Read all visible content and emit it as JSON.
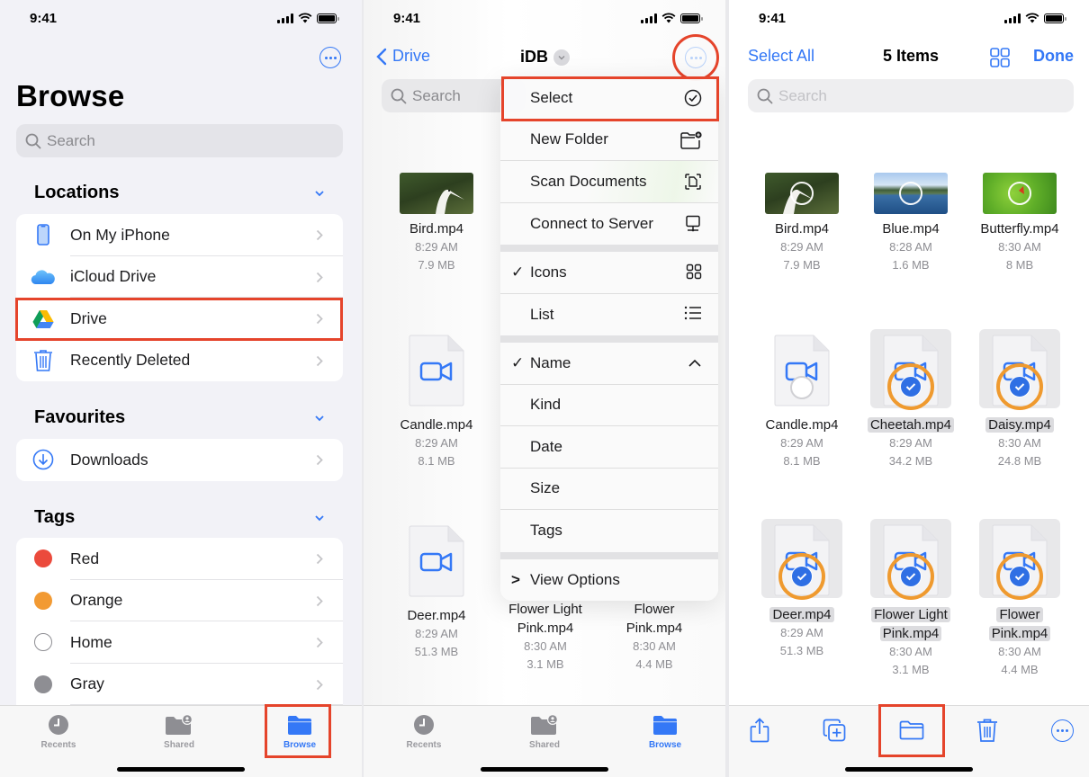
{
  "status_bar": {
    "time": "9:41"
  },
  "colors": {
    "accent": "#3478f6",
    "highlight": "#e5442b",
    "ring": "#ef9a2f",
    "check": "#2f6fe4"
  },
  "panel1": {
    "title": "Browse",
    "more_icon": "ellipsis-circle-icon",
    "search_placeholder": "Search",
    "sections": {
      "locations": {
        "title": "Locations",
        "items": [
          {
            "label": "On My iPhone",
            "icon": "iphone-icon"
          },
          {
            "label": "iCloud Drive",
            "icon": "icloud-icon"
          },
          {
            "label": "Drive",
            "icon": "google-drive-icon",
            "highlighted": true
          },
          {
            "label": "Recently Deleted",
            "icon": "trash-icon"
          }
        ]
      },
      "favourites": {
        "title": "Favourites",
        "items": [
          {
            "label": "Downloads",
            "icon": "download-circle-icon"
          }
        ]
      },
      "tags": {
        "title": "Tags",
        "items": [
          {
            "label": "Red",
            "color": "#eb4a3c"
          },
          {
            "label": "Orange",
            "color": "#f29a33"
          },
          {
            "label": "Home",
            "color": "#ffffff"
          },
          {
            "label": "Gray",
            "color": "#8e8e93"
          }
        ]
      }
    },
    "tabs": [
      {
        "label": "Recents",
        "icon": "clock-icon"
      },
      {
        "label": "Shared",
        "icon": "shared-folder-icon"
      },
      {
        "label": "Browse",
        "icon": "folder-icon",
        "active": true
      }
    ]
  },
  "panel2": {
    "back_label": "Drive",
    "title": "iDB",
    "search_placeholder": "Search",
    "files": [
      {
        "name": "Bird.mp4",
        "time": "8:29 AM",
        "size": "7.9 MB"
      },
      {
        "name": "Candle.mp4",
        "time": "8:29 AM",
        "size": "8.1 MB"
      },
      {
        "name": "Deer.mp4",
        "time": "8:29 AM",
        "size": "51.3 MB"
      },
      {
        "name": "Flower Light Pink.mp4",
        "name_l1": "Flower Light",
        "name_l2": "Pink.mp4",
        "time": "8:30 AM",
        "size": "3.1 MB"
      },
      {
        "name": "Flower Pink.mp4",
        "name_l1": "Flower",
        "name_l2": "Pink.mp4",
        "time": "8:30 AM",
        "size": "4.4 MB"
      }
    ],
    "menu": {
      "group1": [
        {
          "label": "Select",
          "icon": "checkmark-circle-icon",
          "highlighted": true
        },
        {
          "label": "New Folder",
          "icon": "new-folder-icon"
        },
        {
          "label": "Scan Documents",
          "icon": "scan-document-icon"
        },
        {
          "label": "Connect to Server",
          "icon": "server-display-icon"
        }
      ],
      "group2": [
        {
          "label": "Icons",
          "checked": true,
          "icon": "grid-icon"
        },
        {
          "label": "List",
          "checked": false,
          "icon": "list-icon"
        }
      ],
      "group3": [
        {
          "label": "Name",
          "checked": true,
          "icon": "chevron-up-icon"
        },
        {
          "label": "Kind"
        },
        {
          "label": "Date"
        },
        {
          "label": "Size"
        },
        {
          "label": "Tags"
        }
      ],
      "view_options": "View Options",
      "check_glyph": "✓",
      "chevron_glyph": ">"
    },
    "tabs": [
      {
        "label": "Recents"
      },
      {
        "label": "Shared"
      },
      {
        "label": "Browse",
        "active": true
      }
    ]
  },
  "panel3": {
    "select_all": "Select All",
    "title": "5 Items",
    "done": "Done",
    "search_placeholder": "Search",
    "files": [
      {
        "name": "Bird.mp4",
        "time": "8:29 AM",
        "size": "7.9 MB",
        "selected": false
      },
      {
        "name": "Blue.mp4",
        "time": "8:28 AM",
        "size": "1.6 MB",
        "selected": false
      },
      {
        "name": "Butterfly.mp4",
        "time": "8:30 AM",
        "size": "8 MB",
        "selected": false
      },
      {
        "name": "Candle.mp4",
        "time": "8:29 AM",
        "size": "8.1 MB",
        "selected": false
      },
      {
        "name": "Cheetah.mp4",
        "time": "8:29 AM",
        "size": "34.2 MB",
        "selected": true
      },
      {
        "name": "Daisy.mp4",
        "time": "8:30 AM",
        "size": "24.8 MB",
        "selected": true
      },
      {
        "name": "Deer.mp4",
        "time": "8:29 AM",
        "size": "51.3 MB",
        "selected": true
      },
      {
        "name": "Flower Light Pink.mp4",
        "name_l1": "Flower Light",
        "name_l2": "Pink.mp4",
        "time": "8:30 AM",
        "size": "3.1 MB",
        "selected": true
      },
      {
        "name": "Flower Pink.mp4",
        "name_l1": "Flower",
        "name_l2": "Pink.mp4",
        "time": "8:30 AM",
        "size": "4.4 MB",
        "selected": true
      }
    ],
    "toolbar": [
      {
        "icon": "share-icon"
      },
      {
        "icon": "duplicate-icon"
      },
      {
        "icon": "move-folder-icon",
        "highlighted": true
      },
      {
        "icon": "trash-icon"
      },
      {
        "icon": "ellipsis-circle-icon"
      }
    ]
  }
}
